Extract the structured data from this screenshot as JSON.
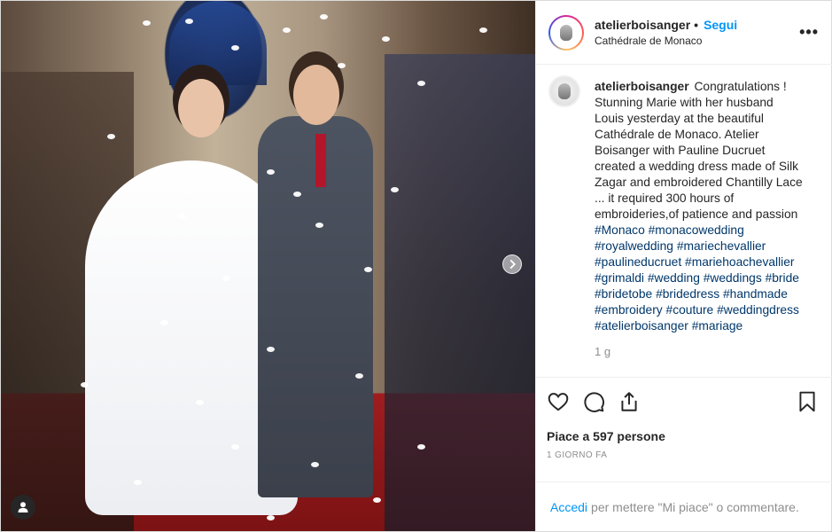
{
  "post": {
    "username": "atelierboisanger",
    "separator": "•",
    "follow_label": "Segui",
    "location": "Cathédrale de Monaco",
    "more_label": "•••"
  },
  "caption": {
    "username": "atelierboisanger",
    "text": "Congratulations ! Stunning Marie with her husband Louis yesterday at the beautiful Cathédrale de Monaco. Atelier Boisanger with Pauline Ducruet created a wedding dress made of Silk Zagar and embroidered Chantilly Lace ... it required 300 hours of embroideries,of patience and passion",
    "hashtags": [
      "#Monaco",
      "#monacowedding",
      "#royalwedding",
      "#mariechevallier",
      "#paulineducruet",
      "#mariehoachevallier",
      "#grimaldi",
      "#wedding",
      "#weddings",
      "#bride",
      "#bridetobe",
      "#bridedress",
      "#handmade",
      "#embroidery",
      "#couture",
      "#weddingdress",
      "#atelierboisanger",
      "#mariage"
    ],
    "time": "1 g"
  },
  "actions": {
    "icons": [
      "heart-icon",
      "comment-icon",
      "share-icon",
      "bookmark-icon"
    ],
    "likes_text": "Piace a 597 persone",
    "date": "1 GIORNO FA"
  },
  "add_comment": {
    "login_link": "Accedi",
    "rest": "per mettere \"Mi piace\" o commentare."
  }
}
